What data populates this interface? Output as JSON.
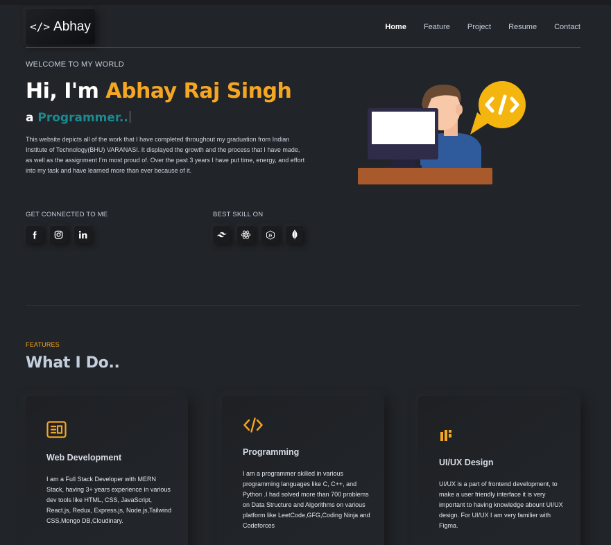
{
  "header": {
    "logo_code": "</>",
    "logo_text": "Abhay",
    "nav": [
      "Home",
      "Feature",
      "Project",
      "Resume",
      "Contact"
    ]
  },
  "hero": {
    "welcome": "WELCOME TO MY WORLD",
    "greeting": "Hi, I'm ",
    "name": "Abhay Raj Singh",
    "role_prefix": "a ",
    "role_typed": "Programmer..",
    "bio": "This website depicts all of the work that I have completed throughout my graduation from Indian Institute of Technology(BHU) VARANASI. It displayed the growth and the process that I have made, as well as the assignment I'm most proud of. Over the past 3 years I have put time, energy, and effort into my task and have learned more than ever because of it."
  },
  "connect": {
    "label": "GET CONNECTED TO ME",
    "icons": [
      "facebook-icon",
      "instagram-icon",
      "linkedin-icon"
    ]
  },
  "skills": {
    "label": "BEST SKILL ON",
    "icons": [
      "tailwind-icon",
      "react-icon",
      "nodejs-icon",
      "mongodb-icon"
    ]
  },
  "features": {
    "label": "FEATURES",
    "title": "What I Do..",
    "cards": [
      {
        "title": "Web Development",
        "text": "I am a Full Stack Developer with MERN Stack, having 3+ years experience in various dev tools like HTML, CSS, JavaScript, React.js, Redux, Express.js, Node.js,Tailwind CSS,Mongo DB,Cloudinary."
      },
      {
        "title": "Programming",
        "text": "I am a programmer skilled in various programming languages like C, C++, and Python .I had solved more than 700 problems on Data Structure and Algorithms on various platform like LeetCode,GFG,Coding Ninja and Codeforces"
      },
      {
        "title": "UI/UX Design",
        "text": "UI/UX is a part of frontend development, to make a user friendly interface it is very important to having knowledge abount UI/UX design. For UI/UX I am very familier with Figma."
      }
    ]
  },
  "colors": {
    "background": "#212428",
    "accent": "#f5a623",
    "teal": "#1b8a8f",
    "text": "#c4cfde"
  }
}
